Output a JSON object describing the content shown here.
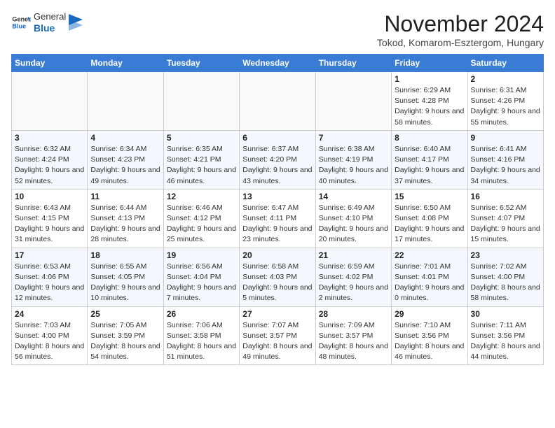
{
  "header": {
    "logo_general": "General",
    "logo_blue": "Blue",
    "month_title": "November 2024",
    "subtitle": "Tokod, Komarom-Esztergom, Hungary"
  },
  "days_of_week": [
    "Sunday",
    "Monday",
    "Tuesday",
    "Wednesday",
    "Thursday",
    "Friday",
    "Saturday"
  ],
  "weeks": [
    [
      {
        "day": "",
        "info": ""
      },
      {
        "day": "",
        "info": ""
      },
      {
        "day": "",
        "info": ""
      },
      {
        "day": "",
        "info": ""
      },
      {
        "day": "",
        "info": ""
      },
      {
        "day": "1",
        "info": "Sunrise: 6:29 AM\nSunset: 4:28 PM\nDaylight: 9 hours and 58 minutes."
      },
      {
        "day": "2",
        "info": "Sunrise: 6:31 AM\nSunset: 4:26 PM\nDaylight: 9 hours and 55 minutes."
      }
    ],
    [
      {
        "day": "3",
        "info": "Sunrise: 6:32 AM\nSunset: 4:24 PM\nDaylight: 9 hours and 52 minutes."
      },
      {
        "day": "4",
        "info": "Sunrise: 6:34 AM\nSunset: 4:23 PM\nDaylight: 9 hours and 49 minutes."
      },
      {
        "day": "5",
        "info": "Sunrise: 6:35 AM\nSunset: 4:21 PM\nDaylight: 9 hours and 46 minutes."
      },
      {
        "day": "6",
        "info": "Sunrise: 6:37 AM\nSunset: 4:20 PM\nDaylight: 9 hours and 43 minutes."
      },
      {
        "day": "7",
        "info": "Sunrise: 6:38 AM\nSunset: 4:19 PM\nDaylight: 9 hours and 40 minutes."
      },
      {
        "day": "8",
        "info": "Sunrise: 6:40 AM\nSunset: 4:17 PM\nDaylight: 9 hours and 37 minutes."
      },
      {
        "day": "9",
        "info": "Sunrise: 6:41 AM\nSunset: 4:16 PM\nDaylight: 9 hours and 34 minutes."
      }
    ],
    [
      {
        "day": "10",
        "info": "Sunrise: 6:43 AM\nSunset: 4:15 PM\nDaylight: 9 hours and 31 minutes."
      },
      {
        "day": "11",
        "info": "Sunrise: 6:44 AM\nSunset: 4:13 PM\nDaylight: 9 hours and 28 minutes."
      },
      {
        "day": "12",
        "info": "Sunrise: 6:46 AM\nSunset: 4:12 PM\nDaylight: 9 hours and 25 minutes."
      },
      {
        "day": "13",
        "info": "Sunrise: 6:47 AM\nSunset: 4:11 PM\nDaylight: 9 hours and 23 minutes."
      },
      {
        "day": "14",
        "info": "Sunrise: 6:49 AM\nSunset: 4:10 PM\nDaylight: 9 hours and 20 minutes."
      },
      {
        "day": "15",
        "info": "Sunrise: 6:50 AM\nSunset: 4:08 PM\nDaylight: 9 hours and 17 minutes."
      },
      {
        "day": "16",
        "info": "Sunrise: 6:52 AM\nSunset: 4:07 PM\nDaylight: 9 hours and 15 minutes."
      }
    ],
    [
      {
        "day": "17",
        "info": "Sunrise: 6:53 AM\nSunset: 4:06 PM\nDaylight: 9 hours and 12 minutes."
      },
      {
        "day": "18",
        "info": "Sunrise: 6:55 AM\nSunset: 4:05 PM\nDaylight: 9 hours and 10 minutes."
      },
      {
        "day": "19",
        "info": "Sunrise: 6:56 AM\nSunset: 4:04 PM\nDaylight: 9 hours and 7 minutes."
      },
      {
        "day": "20",
        "info": "Sunrise: 6:58 AM\nSunset: 4:03 PM\nDaylight: 9 hours and 5 minutes."
      },
      {
        "day": "21",
        "info": "Sunrise: 6:59 AM\nSunset: 4:02 PM\nDaylight: 9 hours and 2 minutes."
      },
      {
        "day": "22",
        "info": "Sunrise: 7:01 AM\nSunset: 4:01 PM\nDaylight: 9 hours and 0 minutes."
      },
      {
        "day": "23",
        "info": "Sunrise: 7:02 AM\nSunset: 4:00 PM\nDaylight: 8 hours and 58 minutes."
      }
    ],
    [
      {
        "day": "24",
        "info": "Sunrise: 7:03 AM\nSunset: 4:00 PM\nDaylight: 8 hours and 56 minutes."
      },
      {
        "day": "25",
        "info": "Sunrise: 7:05 AM\nSunset: 3:59 PM\nDaylight: 8 hours and 54 minutes."
      },
      {
        "day": "26",
        "info": "Sunrise: 7:06 AM\nSunset: 3:58 PM\nDaylight: 8 hours and 51 minutes."
      },
      {
        "day": "27",
        "info": "Sunrise: 7:07 AM\nSunset: 3:57 PM\nDaylight: 8 hours and 49 minutes."
      },
      {
        "day": "28",
        "info": "Sunrise: 7:09 AM\nSunset: 3:57 PM\nDaylight: 8 hours and 48 minutes."
      },
      {
        "day": "29",
        "info": "Sunrise: 7:10 AM\nSunset: 3:56 PM\nDaylight: 8 hours and 46 minutes."
      },
      {
        "day": "30",
        "info": "Sunrise: 7:11 AM\nSunset: 3:56 PM\nDaylight: 8 hours and 44 minutes."
      }
    ]
  ]
}
